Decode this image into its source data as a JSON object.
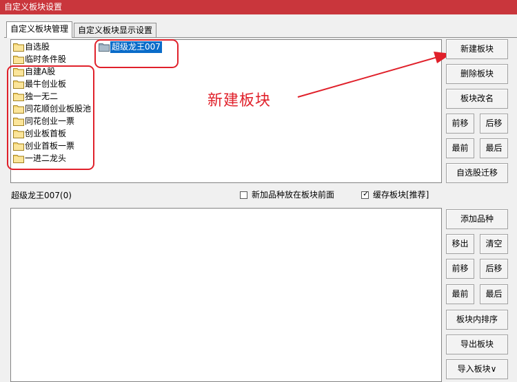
{
  "window": {
    "title": "自定义板块设置"
  },
  "tabs": [
    {
      "label": "自定义板块管理",
      "active": true
    },
    {
      "label": "自定义板块显示设置",
      "active": false
    }
  ],
  "block_list": {
    "items": [
      "自选股",
      "临时条件股",
      "自建A股",
      "最牛创业板",
      "独一无二",
      "同花顺创业板股池",
      "同花创业一票",
      "创业板首板",
      "创业首板一票",
      "一进二龙头"
    ],
    "selected_item": "超级龙王007"
  },
  "annotation": {
    "text": "新建板块",
    "color": "#e0202a"
  },
  "block_buttons": {
    "new": "新建板块",
    "delete": "删除板块",
    "rename": "板块改名",
    "move_up": "前移",
    "move_down": "后移",
    "move_first": "最前",
    "move_last": "最后",
    "migrate": "自选股迁移"
  },
  "current_block": {
    "label": "超级龙王007(0)"
  },
  "options": {
    "add_front": {
      "label": "新加品种放在板块前面",
      "checked": false
    },
    "cache": {
      "label": "缓存板块[推荐]",
      "checked": true
    }
  },
  "stock_buttons": {
    "add": "添加品种",
    "remove": "移出",
    "clear": "清空",
    "move_up": "前移",
    "move_down": "后移",
    "move_first": "最前",
    "move_last": "最后",
    "sort": "板块内排序",
    "export": "导出板块",
    "import": "导入板块∨"
  },
  "colors": {
    "titlebar": "#c9363c",
    "selection": "#0a6cc9",
    "annotation_red": "#e0202a"
  }
}
